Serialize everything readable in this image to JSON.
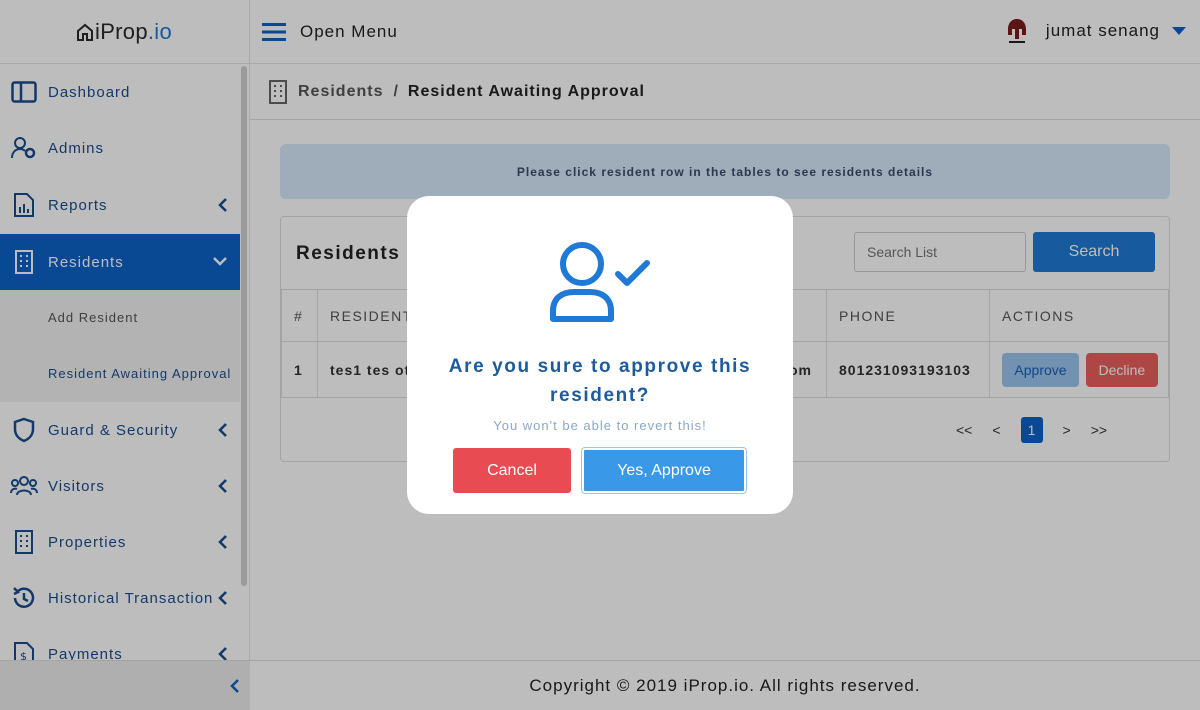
{
  "app": {
    "logo_prefix": "iProp",
    "logo_suffix": ".io"
  },
  "topbar": {
    "menu_label": "Open Menu",
    "user_name": "jumat senang"
  },
  "sidebar": {
    "items": [
      {
        "label": "Dashboard",
        "icon": "dashboard-icon"
      },
      {
        "label": "Admins",
        "icon": "admin-cog-icon"
      },
      {
        "label": "Reports",
        "icon": "report-icon"
      },
      {
        "label": "Residents",
        "icon": "building-icon"
      },
      {
        "label": "Guard & Security",
        "icon": "shield-icon"
      },
      {
        "label": "Visitors",
        "icon": "users-icon"
      },
      {
        "label": "Properties",
        "icon": "building-icon"
      },
      {
        "label": "Historical Transaction",
        "icon": "history-icon"
      },
      {
        "label": "Payments",
        "icon": "invoice-icon"
      }
    ],
    "sub_items": [
      {
        "label": "Add Resident"
      },
      {
        "label": "Resident Awaiting Approval"
      }
    ]
  },
  "breadcrumb": {
    "parent": "Residents",
    "separator": "/",
    "current": "Resident Awaiting Approval"
  },
  "info": {
    "message": "Please click resident row in the tables to see residents details"
  },
  "card": {
    "title": "Residents A",
    "search_placeholder": "Search List",
    "search_label": "Search",
    "columns": [
      "#",
      "RESIDENT",
      "",
      "PHONE",
      "ACTIONS"
    ],
    "rows": [
      {
        "num": "1",
        "resident": "tes1 tes ot",
        "email": "om",
        "phone": "801231093193103",
        "approve": "Approve",
        "decline": "Decline"
      }
    ],
    "pager": {
      "first": "<<",
      "prev": "<",
      "current": "1",
      "next": ">",
      "last": ">>"
    }
  },
  "footer": {
    "text": "Copyright © 2019 iProp.io. All rights reserved."
  },
  "modal": {
    "question": "Are you sure to approve this resident?",
    "subtext": "You won't be able to revert this!",
    "cancel_label": "Cancel",
    "confirm_label": "Yes, Approve"
  },
  "colors": {
    "primary": "#0d63c7",
    "accent": "#1f7ad6",
    "danger": "#e84c52",
    "info_bg": "#d7e8fb"
  }
}
